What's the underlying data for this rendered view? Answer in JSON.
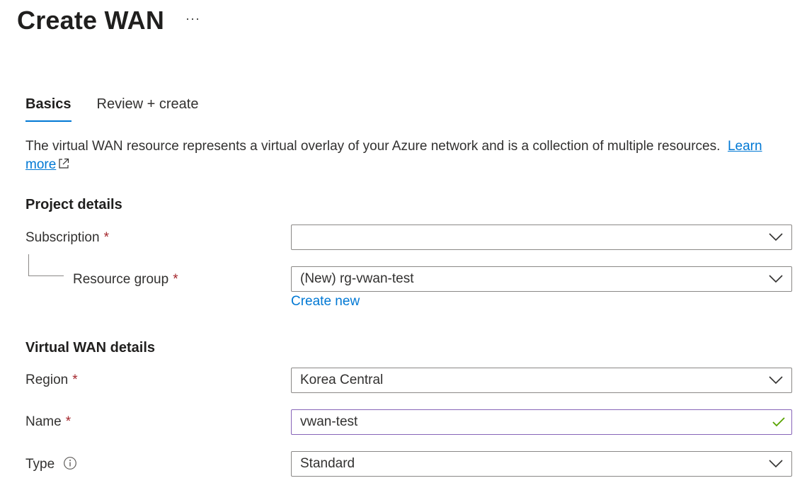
{
  "page": {
    "title": "Create WAN",
    "more_label": "···"
  },
  "tabs": [
    {
      "label": "Basics",
      "active": true
    },
    {
      "label": "Review + create",
      "active": false
    }
  ],
  "description": {
    "text": "The virtual WAN resource represents a virtual overlay of your Azure network and is a collection of multiple resources.",
    "link_part1": "Learn",
    "link_part2": "more"
  },
  "project_details": {
    "heading": "Project details",
    "subscription": {
      "label": "Subscription",
      "required": "*",
      "value": ""
    },
    "resource_group": {
      "label": "Resource group",
      "required": "*",
      "value": "(New) rg-vwan-test",
      "create_new": "Create new"
    }
  },
  "wan_details": {
    "heading": "Virtual WAN details",
    "region": {
      "label": "Region",
      "required": "*",
      "value": "Korea Central"
    },
    "name": {
      "label": "Name",
      "required": "*",
      "value": "vwan-test"
    },
    "type": {
      "label": "Type",
      "value": "Standard"
    }
  },
  "icons": {
    "more": "ellipsis-icon",
    "external": "external-link-icon",
    "dropdown": "chevron-down-icon",
    "valid": "checkmark-icon",
    "info": "info-icon"
  },
  "colors": {
    "accent": "#0078d4",
    "required": "#a4262c",
    "valid_check": "#57a300",
    "valid_border": "#8764b8"
  }
}
